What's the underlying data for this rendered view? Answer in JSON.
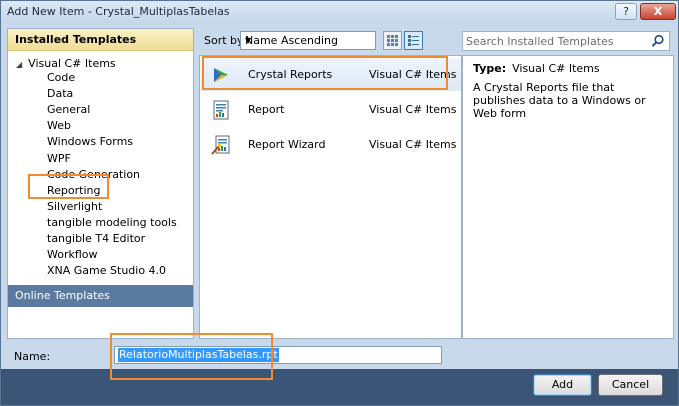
{
  "window": {
    "title": "Add New Item - Crystal_MultiplasTabelas",
    "help_label": "?",
    "close_label": "X"
  },
  "left": {
    "installed_header": "Installed Templates",
    "root": "Visual C# Items",
    "items": [
      "Code",
      "Data",
      "General",
      "Web",
      "Windows Forms",
      "WPF",
      "Code Generation",
      "Reporting",
      "Silverlight",
      "tangible modeling tools",
      "tangible T4 Editor",
      "Workflow",
      "XNA Game Studio 4.0"
    ],
    "online_header": "Online Templates"
  },
  "toolbar": {
    "sort_label": "Sort by:",
    "sort_value": "Name Ascending"
  },
  "search": {
    "placeholder": "Search Installed Templates"
  },
  "templates": [
    {
      "name": "Crystal Reports",
      "lang": "Visual C# Items",
      "icon": "crystal-reports-icon"
    },
    {
      "name": "Report",
      "lang": "Visual C# Items",
      "icon": "report-icon"
    },
    {
      "name": "Report Wizard",
      "lang": "Visual C# Items",
      "icon": "report-wizard-icon"
    }
  ],
  "details": {
    "type_label": "Type:",
    "type_value": "Visual C# Items",
    "description": "A Crystal Reports file that publishes data to a Windows or Web form"
  },
  "name_field": {
    "label": "Name:",
    "value": "RelatorioMultiplasTabelas.rpt"
  },
  "buttons": {
    "add": "Add",
    "cancel": "Cancel"
  },
  "colors": {
    "highlight": "#f28a2e",
    "online_header_bg": "#5a7a9f",
    "bottom_bar": "#3c5475",
    "selection": "#3399ff"
  }
}
